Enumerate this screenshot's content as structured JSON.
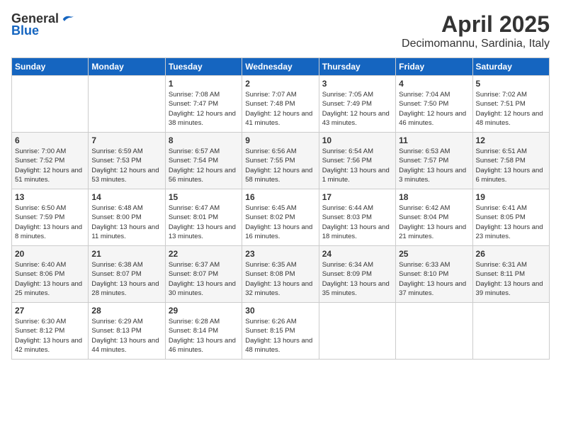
{
  "logo": {
    "general": "General",
    "blue": "Blue"
  },
  "title": "April 2025",
  "subtitle": "Decimomannu, Sardinia, Italy",
  "days_of_week": [
    "Sunday",
    "Monday",
    "Tuesday",
    "Wednesday",
    "Thursday",
    "Friday",
    "Saturday"
  ],
  "weeks": [
    [
      {
        "day": "",
        "info": ""
      },
      {
        "day": "",
        "info": ""
      },
      {
        "day": "1",
        "info": "Sunrise: 7:08 AM\nSunset: 7:47 PM\nDaylight: 12 hours and 38 minutes."
      },
      {
        "day": "2",
        "info": "Sunrise: 7:07 AM\nSunset: 7:48 PM\nDaylight: 12 hours and 41 minutes."
      },
      {
        "day": "3",
        "info": "Sunrise: 7:05 AM\nSunset: 7:49 PM\nDaylight: 12 hours and 43 minutes."
      },
      {
        "day": "4",
        "info": "Sunrise: 7:04 AM\nSunset: 7:50 PM\nDaylight: 12 hours and 46 minutes."
      },
      {
        "day": "5",
        "info": "Sunrise: 7:02 AM\nSunset: 7:51 PM\nDaylight: 12 hours and 48 minutes."
      }
    ],
    [
      {
        "day": "6",
        "info": "Sunrise: 7:00 AM\nSunset: 7:52 PM\nDaylight: 12 hours and 51 minutes."
      },
      {
        "day": "7",
        "info": "Sunrise: 6:59 AM\nSunset: 7:53 PM\nDaylight: 12 hours and 53 minutes."
      },
      {
        "day": "8",
        "info": "Sunrise: 6:57 AM\nSunset: 7:54 PM\nDaylight: 12 hours and 56 minutes."
      },
      {
        "day": "9",
        "info": "Sunrise: 6:56 AM\nSunset: 7:55 PM\nDaylight: 12 hours and 58 minutes."
      },
      {
        "day": "10",
        "info": "Sunrise: 6:54 AM\nSunset: 7:56 PM\nDaylight: 13 hours and 1 minute."
      },
      {
        "day": "11",
        "info": "Sunrise: 6:53 AM\nSunset: 7:57 PM\nDaylight: 13 hours and 3 minutes."
      },
      {
        "day": "12",
        "info": "Sunrise: 6:51 AM\nSunset: 7:58 PM\nDaylight: 13 hours and 6 minutes."
      }
    ],
    [
      {
        "day": "13",
        "info": "Sunrise: 6:50 AM\nSunset: 7:59 PM\nDaylight: 13 hours and 8 minutes."
      },
      {
        "day": "14",
        "info": "Sunrise: 6:48 AM\nSunset: 8:00 PM\nDaylight: 13 hours and 11 minutes."
      },
      {
        "day": "15",
        "info": "Sunrise: 6:47 AM\nSunset: 8:01 PM\nDaylight: 13 hours and 13 minutes."
      },
      {
        "day": "16",
        "info": "Sunrise: 6:45 AM\nSunset: 8:02 PM\nDaylight: 13 hours and 16 minutes."
      },
      {
        "day": "17",
        "info": "Sunrise: 6:44 AM\nSunset: 8:03 PM\nDaylight: 13 hours and 18 minutes."
      },
      {
        "day": "18",
        "info": "Sunrise: 6:42 AM\nSunset: 8:04 PM\nDaylight: 13 hours and 21 minutes."
      },
      {
        "day": "19",
        "info": "Sunrise: 6:41 AM\nSunset: 8:05 PM\nDaylight: 13 hours and 23 minutes."
      }
    ],
    [
      {
        "day": "20",
        "info": "Sunrise: 6:40 AM\nSunset: 8:06 PM\nDaylight: 13 hours and 25 minutes."
      },
      {
        "day": "21",
        "info": "Sunrise: 6:38 AM\nSunset: 8:07 PM\nDaylight: 13 hours and 28 minutes."
      },
      {
        "day": "22",
        "info": "Sunrise: 6:37 AM\nSunset: 8:07 PM\nDaylight: 13 hours and 30 minutes."
      },
      {
        "day": "23",
        "info": "Sunrise: 6:35 AM\nSunset: 8:08 PM\nDaylight: 13 hours and 32 minutes."
      },
      {
        "day": "24",
        "info": "Sunrise: 6:34 AM\nSunset: 8:09 PM\nDaylight: 13 hours and 35 minutes."
      },
      {
        "day": "25",
        "info": "Sunrise: 6:33 AM\nSunset: 8:10 PM\nDaylight: 13 hours and 37 minutes."
      },
      {
        "day": "26",
        "info": "Sunrise: 6:31 AM\nSunset: 8:11 PM\nDaylight: 13 hours and 39 minutes."
      }
    ],
    [
      {
        "day": "27",
        "info": "Sunrise: 6:30 AM\nSunset: 8:12 PM\nDaylight: 13 hours and 42 minutes."
      },
      {
        "day": "28",
        "info": "Sunrise: 6:29 AM\nSunset: 8:13 PM\nDaylight: 13 hours and 44 minutes."
      },
      {
        "day": "29",
        "info": "Sunrise: 6:28 AM\nSunset: 8:14 PM\nDaylight: 13 hours and 46 minutes."
      },
      {
        "day": "30",
        "info": "Sunrise: 6:26 AM\nSunset: 8:15 PM\nDaylight: 13 hours and 48 minutes."
      },
      {
        "day": "",
        "info": ""
      },
      {
        "day": "",
        "info": ""
      },
      {
        "day": "",
        "info": ""
      }
    ]
  ]
}
